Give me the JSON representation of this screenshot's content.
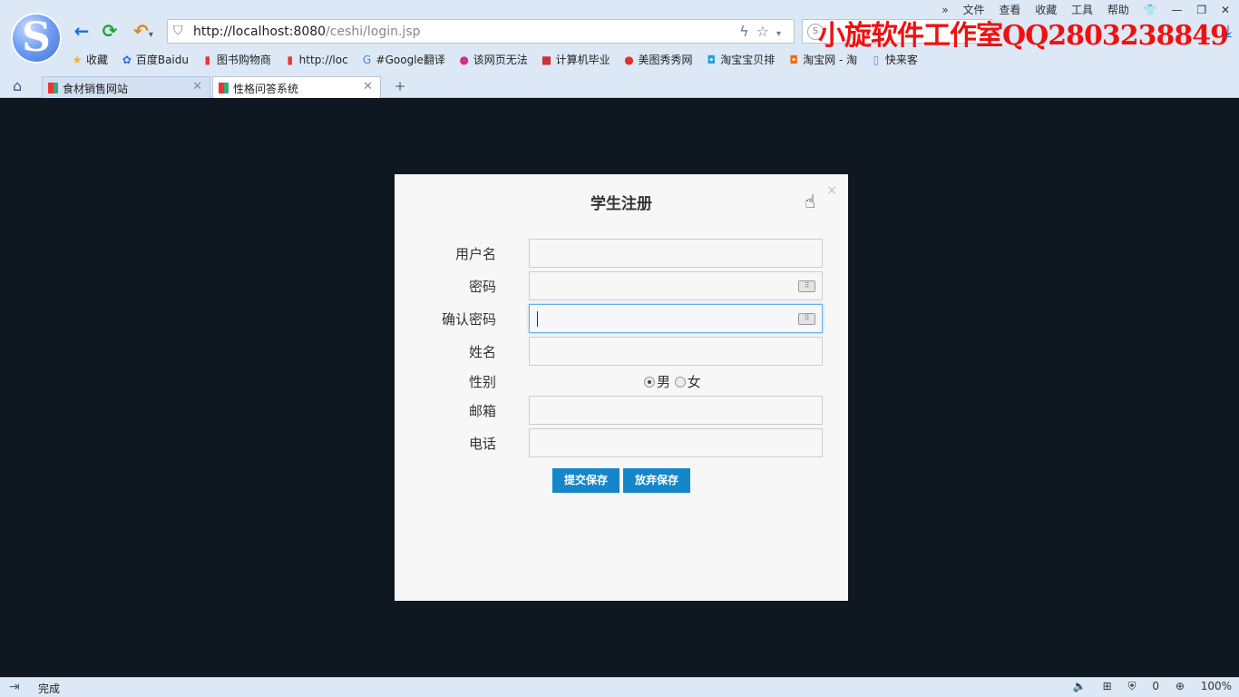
{
  "browser": {
    "url_host": "http://localhost:8080",
    "url_path": "/ceshi/login.jsp",
    "watermark": "小旋软件工作室QQ2803238849",
    "menu": [
      "»",
      "文件",
      "查看",
      "收藏",
      "工具",
      "帮助"
    ],
    "bookmarks": [
      {
        "icon": "star-icon",
        "label": "收藏"
      },
      {
        "icon": "baidu-icon",
        "label": "百度Baidu"
      },
      {
        "icon": "page-icon",
        "label": "图书购物商"
      },
      {
        "icon": "page-icon",
        "label": "http://loc"
      },
      {
        "icon": "google-translate-icon",
        "label": "#Google翻译"
      },
      {
        "icon": "sogou-icon",
        "label": "该网页无法"
      },
      {
        "icon": "bi-icon",
        "label": "计算机毕业"
      },
      {
        "icon": "meitu-icon",
        "label": "美图秀秀网"
      },
      {
        "icon": "taobao-icon",
        "label": "淘宝宝贝排"
      },
      {
        "icon": "taobao-icon",
        "label": "淘宝网 - 淘"
      },
      {
        "icon": "doc-icon",
        "label": "快来客"
      }
    ],
    "tabs": [
      {
        "label": "食材销售网站",
        "active": false
      },
      {
        "label": "性格问答系统",
        "active": true
      }
    ],
    "status_text": "完成",
    "status_right": {
      "shield_count": "0",
      "zoom": "100%"
    }
  },
  "dialog": {
    "title": "学生注册",
    "fields": {
      "username_label": "用户名",
      "password_label": "密码",
      "confirm_label": "确认密码",
      "name_label": "姓名",
      "gender_label": "性别",
      "email_label": "邮箱",
      "phone_label": "电话"
    },
    "gender": {
      "male": "男",
      "female": "女",
      "selected": "男"
    },
    "submit_label": "提交保存",
    "cancel_label": "放弃保存"
  }
}
